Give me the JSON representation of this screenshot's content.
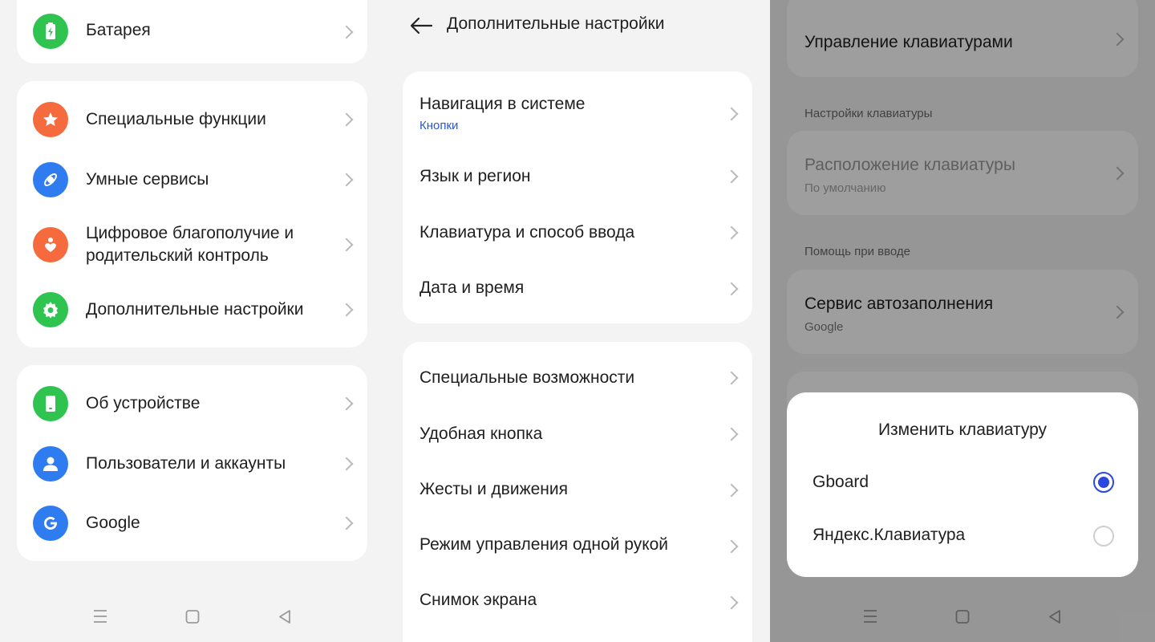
{
  "panel1": {
    "group1": [
      {
        "label": "Батарея",
        "icon": "battery-icon",
        "color": "#2fc450"
      }
    ],
    "group2": [
      {
        "label": "Специальные функции",
        "icon": "star-icon",
        "color": "#f56b3d"
      },
      {
        "label": "Умные сервисы",
        "icon": "satellite-icon",
        "color": "#2f7bf0"
      },
      {
        "label": "Цифровое благополучие и",
        "label2": "родительский контроль",
        "icon": "heart-person-icon",
        "color": "#f56b3d"
      },
      {
        "label": "Дополнительные настройки",
        "icon": "gear-icon",
        "color": "#2fc450"
      }
    ],
    "group3": [
      {
        "label": "Об устройстве",
        "icon": "phone-icon",
        "color": "#2fc450"
      },
      {
        "label": "Пользователи и аккаунты",
        "icon": "user-icon",
        "color": "#2f7bf0"
      },
      {
        "label": "Google",
        "icon": "google-icon",
        "color": "#2f7bf0"
      }
    ]
  },
  "panel2": {
    "title": "Дополнительные настройки",
    "group1": [
      {
        "label": "Навигация в системе",
        "sub": "Кнопки"
      },
      {
        "label": "Язык и регион"
      },
      {
        "label": "Клавиатура и способ ввода"
      },
      {
        "label": "Дата и время"
      }
    ],
    "group2": [
      {
        "label": "Специальные возможности"
      },
      {
        "label": "Удобная кнопка"
      },
      {
        "label": "Жесты и движения"
      },
      {
        "label": "Режим управления одной рукой"
      },
      {
        "label": "Снимок экрана"
      }
    ]
  },
  "panel3": {
    "manage_keyboards": "Управление клавиатурами",
    "section_keyboard_settings": "Настройки клавиатуры",
    "layout_label": "Расположение клавиатуры",
    "layout_sub": "По умолчанию",
    "section_input_help": "Помощь при вводе",
    "autofill_label": "Сервис автозаполнения",
    "autofill_sub": "Google",
    "dialog": {
      "title": "Изменить клавиатуру",
      "options": [
        {
          "label": "Gboard",
          "selected": true
        },
        {
          "label": "Яндекс.Клавиатура",
          "selected": false
        }
      ]
    }
  }
}
